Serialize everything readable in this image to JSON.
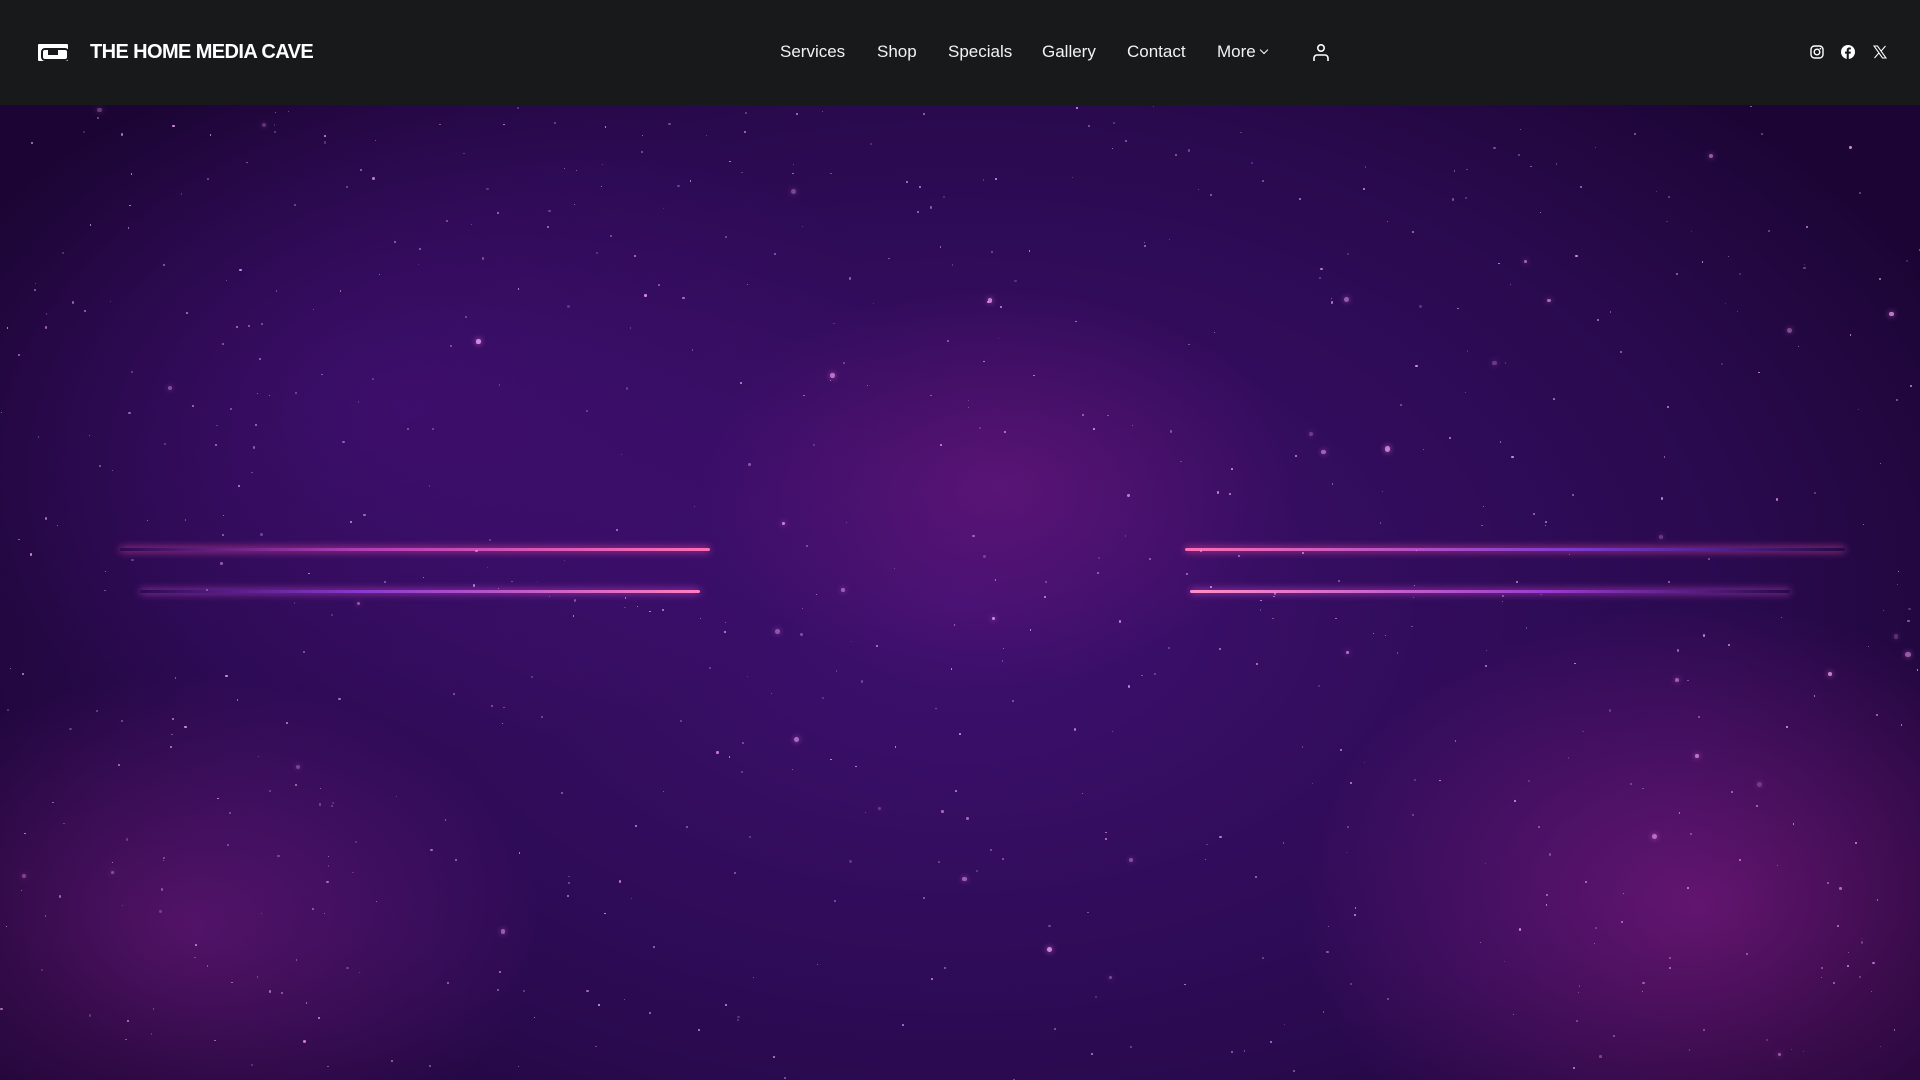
{
  "brand": {
    "name": "THE HOME MEDIA CAVE",
    "logo_icon": "vhs-tape-icon"
  },
  "nav": {
    "items": [
      {
        "label": "Services"
      },
      {
        "label": "Shop"
      },
      {
        "label": "Specials"
      },
      {
        "label": "Gallery"
      },
      {
        "label": "Contact"
      },
      {
        "label": "More"
      }
    ]
  },
  "icons": {
    "account": "user-icon",
    "social": [
      "instagram-icon",
      "facebook-icon",
      "x-icon"
    ]
  },
  "colors": {
    "header": "#18191b",
    "hero": "#3e1070",
    "accent": "#ff4fa8"
  }
}
